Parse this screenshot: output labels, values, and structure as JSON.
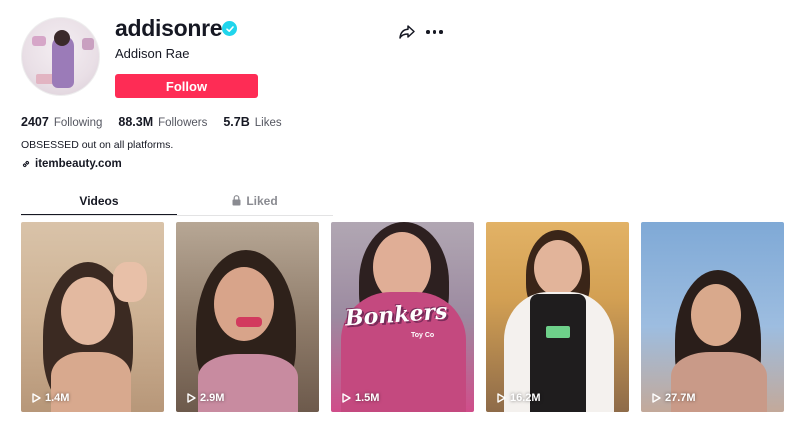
{
  "profile": {
    "username": "addisonre",
    "nickname": "Addison Rae",
    "follow_label": "Follow",
    "bio": "OBSESSED out on all platforms.",
    "link": "itembeauty.com",
    "verified": true
  },
  "stats": [
    {
      "value": "2407",
      "label": "Following"
    },
    {
      "value": "88.3M",
      "label": "Followers"
    },
    {
      "value": "5.7B",
      "label": "Likes"
    }
  ],
  "tabs": [
    {
      "label": "Videos",
      "active": true
    },
    {
      "label": "Liked",
      "active": false,
      "icon": "lock-icon"
    }
  ],
  "videos": [
    {
      "views": "1.4M"
    },
    {
      "views": "2.9M"
    },
    {
      "views": "1.5M",
      "overlay_text": "Bonkers",
      "overlay_sub": "Toy Co"
    },
    {
      "views": "16.2M"
    },
    {
      "views": "27.7M"
    }
  ],
  "colors": {
    "accent": "#fe2c55",
    "verified": "#20d5ec",
    "text": "#161823",
    "muted": "#545660"
  }
}
